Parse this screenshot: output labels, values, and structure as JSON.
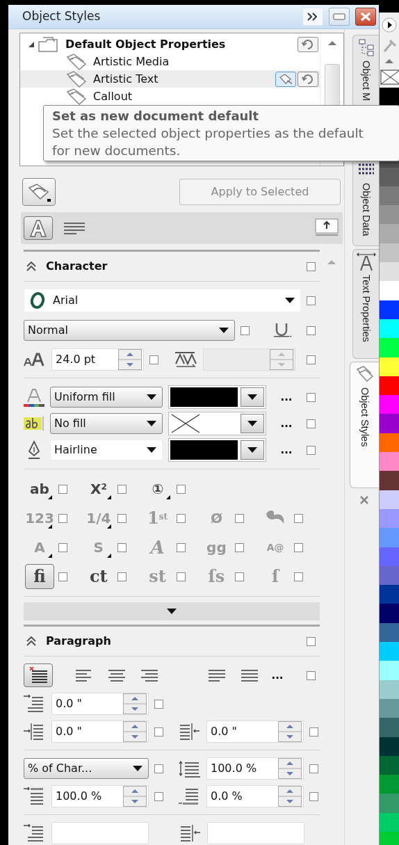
{
  "window": {
    "title": "Object Styles"
  },
  "tree": {
    "items": [
      {
        "label": "Default Object Properties",
        "expanded": true,
        "selected": false,
        "children": [
          {
            "label": "Artistic Media",
            "selected": false
          },
          {
            "label": "Artistic Text",
            "selected": true
          },
          {
            "label": "Callout",
            "selected": false
          }
        ]
      }
    ]
  },
  "tooltip": {
    "title": "Set as new document default",
    "text": "Set the selected object properties as the default for new documents."
  },
  "apply_button": {
    "label": "Apply to Selected",
    "disabled": true
  },
  "view_toggles": [
    {
      "kind": "character",
      "selected": true
    },
    {
      "kind": "paragraph",
      "selected": false
    }
  ],
  "character": {
    "title": "Character",
    "expanded": true,
    "checked": false,
    "font": {
      "value": "Arial",
      "checked": false
    },
    "style": {
      "value": "Normal",
      "checked": false
    },
    "underline": {
      "checked": false
    },
    "size": {
      "value": "24.0 pt",
      "checked": false
    },
    "kerning": {
      "disabled": true,
      "checked": false
    },
    "fills": [
      {
        "kind": "text",
        "type": "Uniform fill",
        "color": "#000000",
        "more": "...",
        "checked": false
      },
      {
        "kind": "background",
        "type": "No fill",
        "more": "...",
        "checked": false
      },
      {
        "kind": "outline",
        "type": "Hairline",
        "color": "#000000",
        "more": "...",
        "checked": false
      }
    ],
    "features": [
      [
        {
          "label": "ab",
          "kind": "sans",
          "flyout": true,
          "disabled": false,
          "selected": false,
          "checked": false
        },
        {
          "label": "X$^{2}$",
          "kind": "sans",
          "flyout": true,
          "disabled": false,
          "selected": false,
          "checked": false
        },
        {
          "label": "①",
          "kind": "sans",
          "flyout": true,
          "disabled": false,
          "selected": false,
          "checked": false
        }
      ],
      [
        {
          "label": "123",
          "kind": "sans",
          "flyout": true,
          "disabled": true,
          "selected": false,
          "checked": false
        },
        {
          "label": "1/4",
          "kind": "sans",
          "flyout": true,
          "disabled": true,
          "selected": false,
          "checked": false
        },
        {
          "label": "1$^{st}$",
          "kind": "serif",
          "flyout": false,
          "disabled": true,
          "selected": false,
          "checked": false
        },
        {
          "label": "Ø",
          "kind": "sans",
          "flyout": false,
          "disabled": true,
          "selected": false,
          "checked": false
        },
        {
          "kind": "swash",
          "flyout": false,
          "disabled": true,
          "selected": false,
          "checked": false
        }
      ],
      [
        {
          "label": "A",
          "kind": "sans",
          "flyout": true,
          "disabled": true,
          "selected": false,
          "checked": false
        },
        {
          "label": "S",
          "kind": "sans",
          "flyout": true,
          "disabled": true,
          "selected": false,
          "checked": false
        },
        {
          "label": "A",
          "kind": "script",
          "flyout": false,
          "disabled": true,
          "selected": false,
          "checked": false
        },
        {
          "label": "gg",
          "kind": "sans",
          "flyout": false,
          "disabled": true,
          "selected": false,
          "checked": false
        },
        {
          "label": "A@",
          "kind": "small",
          "flyout": false,
          "disabled": true,
          "selected": false,
          "checked": false
        }
      ],
      [
        {
          "label": "fi",
          "kind": "serif",
          "flyout": false,
          "disabled": false,
          "selected": true,
          "checked": false
        },
        {
          "label": "ct",
          "kind": "serif",
          "flyout": false,
          "disabled": false,
          "selected": false,
          "checked": false
        },
        {
          "label": "st",
          "kind": "serif",
          "flyout": false,
          "disabled": true,
          "selected": false,
          "checked": false
        },
        {
          "label": "ſs",
          "kind": "serif",
          "flyout": false,
          "disabled": true,
          "selected": false,
          "checked": false
        },
        {
          "label": "ſ",
          "kind": "serif",
          "flyout": false,
          "disabled": true,
          "selected": false,
          "checked": false
        }
      ]
    ]
  },
  "paragraph": {
    "title": "Paragraph",
    "expanded": true,
    "checked": false,
    "alignments": [
      {
        "kind": "none",
        "selected": true
      },
      {
        "kind": "left",
        "selected": false
      },
      {
        "kind": "center",
        "selected": false
      },
      {
        "kind": "right",
        "selected": false
      },
      {
        "kind": "full",
        "selected": false
      },
      {
        "kind": "force",
        "selected": false
      }
    ],
    "alignment_more": "...",
    "alignment_checked": false,
    "first_line_indent": {
      "value": "0.0 \"",
      "checked": false
    },
    "left_indent": {
      "value": "0.0 \"",
      "checked": false
    },
    "right_indent": {
      "value": "0.0 \"",
      "checked": false
    },
    "spacing_unit": {
      "value": "% of Char...",
      "checked": false
    },
    "line_spacing": {
      "value": "100.0 %",
      "checked": false
    },
    "before_spacing": {
      "value": "100.0 %",
      "checked": false
    },
    "after_spacing": {
      "value": "0.0 %",
      "checked": false
    }
  },
  "side_tabs": [
    {
      "kind": "manager",
      "label": "Object M",
      "selected": false
    },
    {
      "kind": "data",
      "label": "Object Data",
      "selected": false
    },
    {
      "kind": "text",
      "label": "Text Properties",
      "selected": false
    },
    {
      "kind": "styles",
      "label": "Object Styles",
      "selected": true
    }
  ],
  "palette": {
    "colors": [
      {
        "color": "#000000"
      },
      {
        "color": "#4d4d4d"
      },
      {
        "color": "#5e5e5e"
      },
      {
        "color": "#7a7a7a"
      },
      {
        "color": "#939393"
      },
      {
        "color": "#ababab"
      },
      {
        "color": "#c4c4c4"
      },
      {
        "color": "#e0e0e0"
      },
      {
        "color": "#ffffff"
      },
      {
        "color": "#0033ff"
      },
      {
        "color": "#00ffff"
      },
      {
        "color": "#00ff44"
      },
      {
        "color": "#ffff33"
      },
      {
        "color": "#ff0000"
      },
      {
        "color": "#ff00ff"
      },
      {
        "color": "#9900cc"
      },
      {
        "color": "#ff6600"
      },
      {
        "color": "#ff88c8"
      },
      {
        "color": "#663333"
      },
      {
        "color": "#ccccff"
      },
      {
        "color": "#9999ff"
      },
      {
        "color": "#6699ff"
      },
      {
        "color": "#6666ff"
      },
      {
        "color": "#6666cc"
      },
      {
        "color": "#003399"
      },
      {
        "color": "#000066"
      },
      {
        "color": "#336699"
      },
      {
        "color": "#00ccff"
      },
      {
        "color": "#99ffff"
      },
      {
        "color": "#99cccc"
      },
      {
        "color": "#669999"
      },
      {
        "color": "#336666"
      },
      {
        "color": "#003333"
      },
      {
        "color": "#006633"
      },
      {
        "color": "#009933"
      },
      {
        "color": "#339966"
      },
      {
        "color": "#00cc66"
      },
      {
        "color": "#00cc33"
      }
    ]
  }
}
